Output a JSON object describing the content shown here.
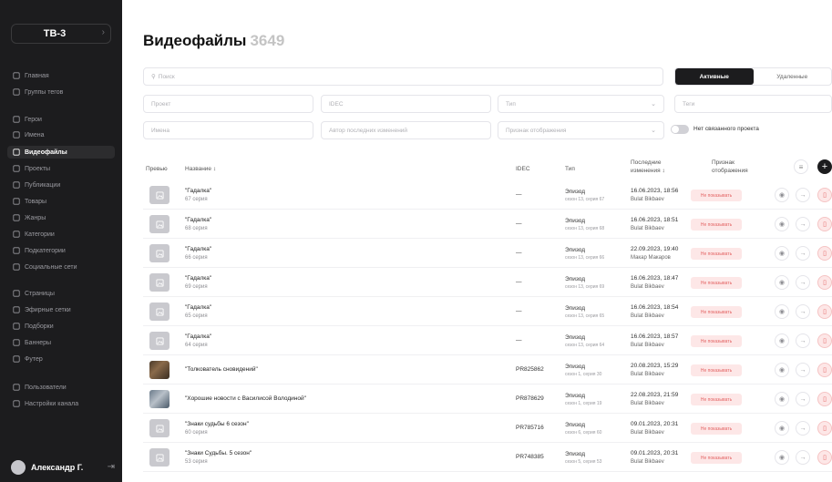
{
  "sidebar": {
    "brand": "ТВ-3",
    "items": [
      {
        "label": "Главная",
        "icon": "home-icon"
      },
      {
        "label": "Группы тегов",
        "icon": "tag-group-icon"
      },
      {
        "label": "Герои",
        "icon": "hero-icon"
      },
      {
        "label": "Имена",
        "icon": "star-icon"
      },
      {
        "label": "Видеофайлы",
        "icon": "video-icon",
        "active": true
      },
      {
        "label": "Проекты",
        "icon": "projects-icon"
      },
      {
        "label": "Публикации",
        "icon": "publications-icon"
      },
      {
        "label": "Товары",
        "icon": "goods-icon"
      },
      {
        "label": "Жанры",
        "icon": "genres-icon"
      },
      {
        "label": "Категории",
        "icon": "categories-icon"
      },
      {
        "label": "Подкатегории",
        "icon": "subcategories-icon"
      },
      {
        "label": "Социальные сети",
        "icon": "social-icon"
      },
      {
        "label": "Страницы",
        "icon": "pages-icon"
      },
      {
        "label": "Эфирные сетки",
        "icon": "broadcast-icon"
      },
      {
        "label": "Подборки",
        "icon": "collections-icon"
      },
      {
        "label": "Баннеры",
        "icon": "banners-icon"
      },
      {
        "label": "Футер",
        "icon": "footer-icon"
      },
      {
        "label": "Пользователи",
        "icon": "users-icon"
      },
      {
        "label": "Настройки канала",
        "icon": "settings-icon"
      }
    ],
    "user_name": "Александр Г."
  },
  "page": {
    "title": "Видеофайлы",
    "count": "3649"
  },
  "filters": {
    "search_placeholder": "Поиск",
    "project": "Проект",
    "idec": "IDEC",
    "type": "Тип",
    "tags": "Теги",
    "names": "Имена",
    "author": "Автор последних изменений",
    "display_flag": "Признак отображения",
    "no_project": "Нет связанного проекта",
    "tab_active": "Активные",
    "tab_deleted": "Удаленные"
  },
  "table": {
    "headers": {
      "preview": "Превью",
      "name": "Название ↕",
      "idec": "IDEC",
      "type": "Тип",
      "changed_line1": "Последние",
      "changed_line2": "изменения ↕",
      "flag_line1": "Признак",
      "flag_line2": "отображения"
    },
    "rows": [
      {
        "thumb": "placeholder",
        "name": "\"Гадалка\"",
        "sub": "67 серия",
        "idec": "—",
        "type": "Эпизод",
        "type_sub": "сезон 13, серия 67",
        "date": "16.06.2023, 18:56",
        "author": "Bulat Bikbaev",
        "badge": "Не показывать"
      },
      {
        "thumb": "placeholder",
        "name": "\"Гадалка\"",
        "sub": "68 серия",
        "idec": "—",
        "type": "Эпизод",
        "type_sub": "сезон 13, серия 68",
        "date": "16.06.2023, 18:51",
        "author": "Bulat Bikbaev",
        "badge": "Не показывать"
      },
      {
        "thumb": "placeholder",
        "name": "\"Гадалка\"",
        "sub": "66 серия",
        "idec": "—",
        "type": "Эпизод",
        "type_sub": "сезон 13, серия 66",
        "date": "22.09.2023, 19:40",
        "author": "Макар Макаров",
        "badge": "Не показывать"
      },
      {
        "thumb": "placeholder",
        "name": "\"Гадалка\"",
        "sub": "69 серия",
        "idec": "—",
        "type": "Эпизод",
        "type_sub": "сезон 13, серия 69",
        "date": "16.06.2023, 18:47",
        "author": "Bulat Bikbaev",
        "badge": "Не показывать"
      },
      {
        "thumb": "placeholder",
        "name": "\"Гадалка\"",
        "sub": "65 серия",
        "idec": "—",
        "type": "Эпизод",
        "type_sub": "сезон 13, серия 65",
        "date": "16.06.2023, 18:54",
        "author": "Bulat Bikbaev",
        "badge": "Не показывать"
      },
      {
        "thumb": "placeholder",
        "name": "\"Гадалка\"",
        "sub": "64 серия",
        "idec": "—",
        "type": "Эпизод",
        "type_sub": "сезон 13, серия 64",
        "date": "16.06.2023, 18:57",
        "author": "Bulat Bikbaev",
        "badge": "Не показывать"
      },
      {
        "thumb": "photo1",
        "name": "\"Толкователь сновидений\"",
        "sub": "",
        "idec": "PR825862",
        "type": "Эпизод",
        "type_sub": "сезон 1, серия 30",
        "date": "20.08.2023, 15:29",
        "author": "Bulat Bikbaev",
        "badge": "Не показывать"
      },
      {
        "thumb": "photo2",
        "name": "\"Хорошие новости с Василисой Володиной\"",
        "sub": "",
        "idec": "PR878629",
        "type": "Эпизод",
        "type_sub": "сезон 1, серия 19",
        "date": "22.08.2023, 21:59",
        "author": "Bulat Bikbaev",
        "badge": "Не показывать"
      },
      {
        "thumb": "placeholder",
        "name": "\"Знаки судьбы 6 сезон\"",
        "sub": "60 серия",
        "idec": "PR785716",
        "type": "Эпизод",
        "type_sub": "сезон 6, серия 60",
        "date": "09.01.2023, 20:31",
        "author": "Bulat Bikbaev",
        "badge": "Не показывать"
      },
      {
        "thumb": "placeholder",
        "name": "\"Знаки Судьбы. 5 сезон\"",
        "sub": "53 серия",
        "idec": "PR748385",
        "type": "Эпизод",
        "type_sub": "сезон 5, серия 53",
        "date": "09.01.2023, 20:31",
        "author": "Bulat Bikbaev",
        "badge": "Не показывать"
      }
    ]
  }
}
